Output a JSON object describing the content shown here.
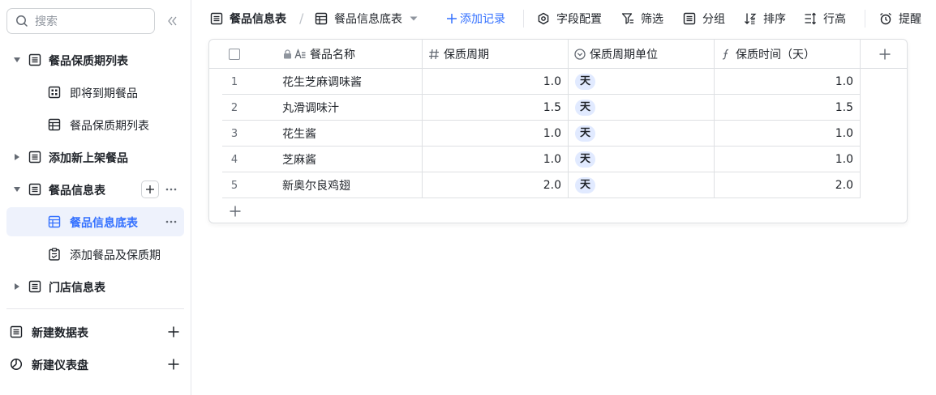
{
  "search": {
    "placeholder": "搜索"
  },
  "sidebar": {
    "items": [
      {
        "label": "餐品保质期列表"
      },
      {
        "label": "即将到期餐品"
      },
      {
        "label": "餐品保质期列表"
      },
      {
        "label": "添加新上架餐品"
      },
      {
        "label": "餐品信息表"
      },
      {
        "label": "餐品信息底表"
      },
      {
        "label": "添加餐品及保质期"
      },
      {
        "label": "门店信息表"
      }
    ],
    "new_table_label": "新建数据表",
    "new_dashboard_label": "新建仪表盘"
  },
  "toolbar": {
    "breadcrumb_parent": "餐品信息表",
    "breadcrumb_current": "餐品信息底表",
    "add_record_label": "添加记录",
    "field_config_label": "字段配置",
    "filter_label": "筛选",
    "group_label": "分组",
    "sort_label": "排序",
    "row_height_label": "行高",
    "reminder_label": "提醒"
  },
  "table": {
    "headers": {
      "name": "餐品名称",
      "period": "保质周期",
      "unit": "保质周期单位",
      "days": "保质时间（天）"
    },
    "rows": [
      {
        "num": "1",
        "name": "花生芝麻调味酱",
        "period": "1.0",
        "unit": "天",
        "days": "1.0"
      },
      {
        "num": "2",
        "name": "丸滑调味汁",
        "period": "1.5",
        "unit": "天",
        "days": "1.5"
      },
      {
        "num": "3",
        "name": "花生酱",
        "period": "1.0",
        "unit": "天",
        "days": "1.0"
      },
      {
        "num": "4",
        "name": "芝麻酱",
        "period": "1.0",
        "unit": "天",
        "days": "1.0"
      },
      {
        "num": "5",
        "name": "新奥尔良鸡翅",
        "period": "2.0",
        "unit": "天",
        "days": "2.0"
      }
    ]
  },
  "colors": {
    "accent": "#3370ff",
    "active_bg": "#eef2fc",
    "tag_bg": "#e1eaff",
    "border": "#dee0e3"
  }
}
